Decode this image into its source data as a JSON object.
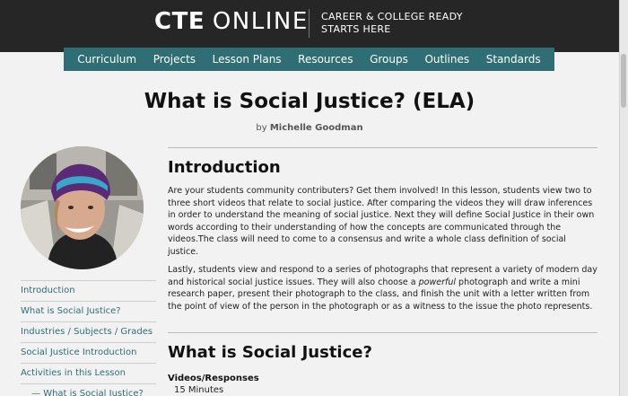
{
  "header": {
    "logo_bold": "CTE",
    "logo_light": "ONLINE",
    "tagline_line1": "CAREER & COLLEGE READY",
    "tagline_line2": "STARTS HERE"
  },
  "nav": {
    "items": [
      "Curriculum",
      "Projects",
      "Lesson Plans",
      "Resources",
      "Groups",
      "Outlines",
      "Standards"
    ]
  },
  "page": {
    "title": "What is Social Justice? (ELA)",
    "author_prefix": "by",
    "author_name": "Michelle Goodman"
  },
  "sidebar": {
    "items": [
      "Introduction",
      "What is Social Justice?",
      "Industries / Subjects / Grades",
      "Social Justice Introduction",
      "Activities in this Lesson",
      "What is Social Justice?"
    ]
  },
  "content": {
    "intro_heading": "Introduction",
    "intro_p1": "Are your students community contributers? Get them involved! In this lesson, students view two to three short videos that relate to social justice. After comparing the videos they will draw inferences in order to understand the meaning of social justice. Next they will define Social Justice in their own words according to their understanding of how the concepts are communicated through the videos.The class will need to come to a consensus and write a whole class definition of social justice.",
    "intro_p2_a": "Lastly, students view and respond to a series of photographs that represent a variety of modern day and historical social justice issues. They will also choose a ",
    "intro_p2_em": "powerful",
    "intro_p2_b": " photograph and write a mini research paper, present their photograph to the class, and finish the unit with a letter written from the point of view of the person in the photograph or as a witness to the issue the photo represents.",
    "section2_heading": "What is Social Justice?",
    "videos_label": "Videos/Responses",
    "videos_time": "15 Minutes"
  }
}
